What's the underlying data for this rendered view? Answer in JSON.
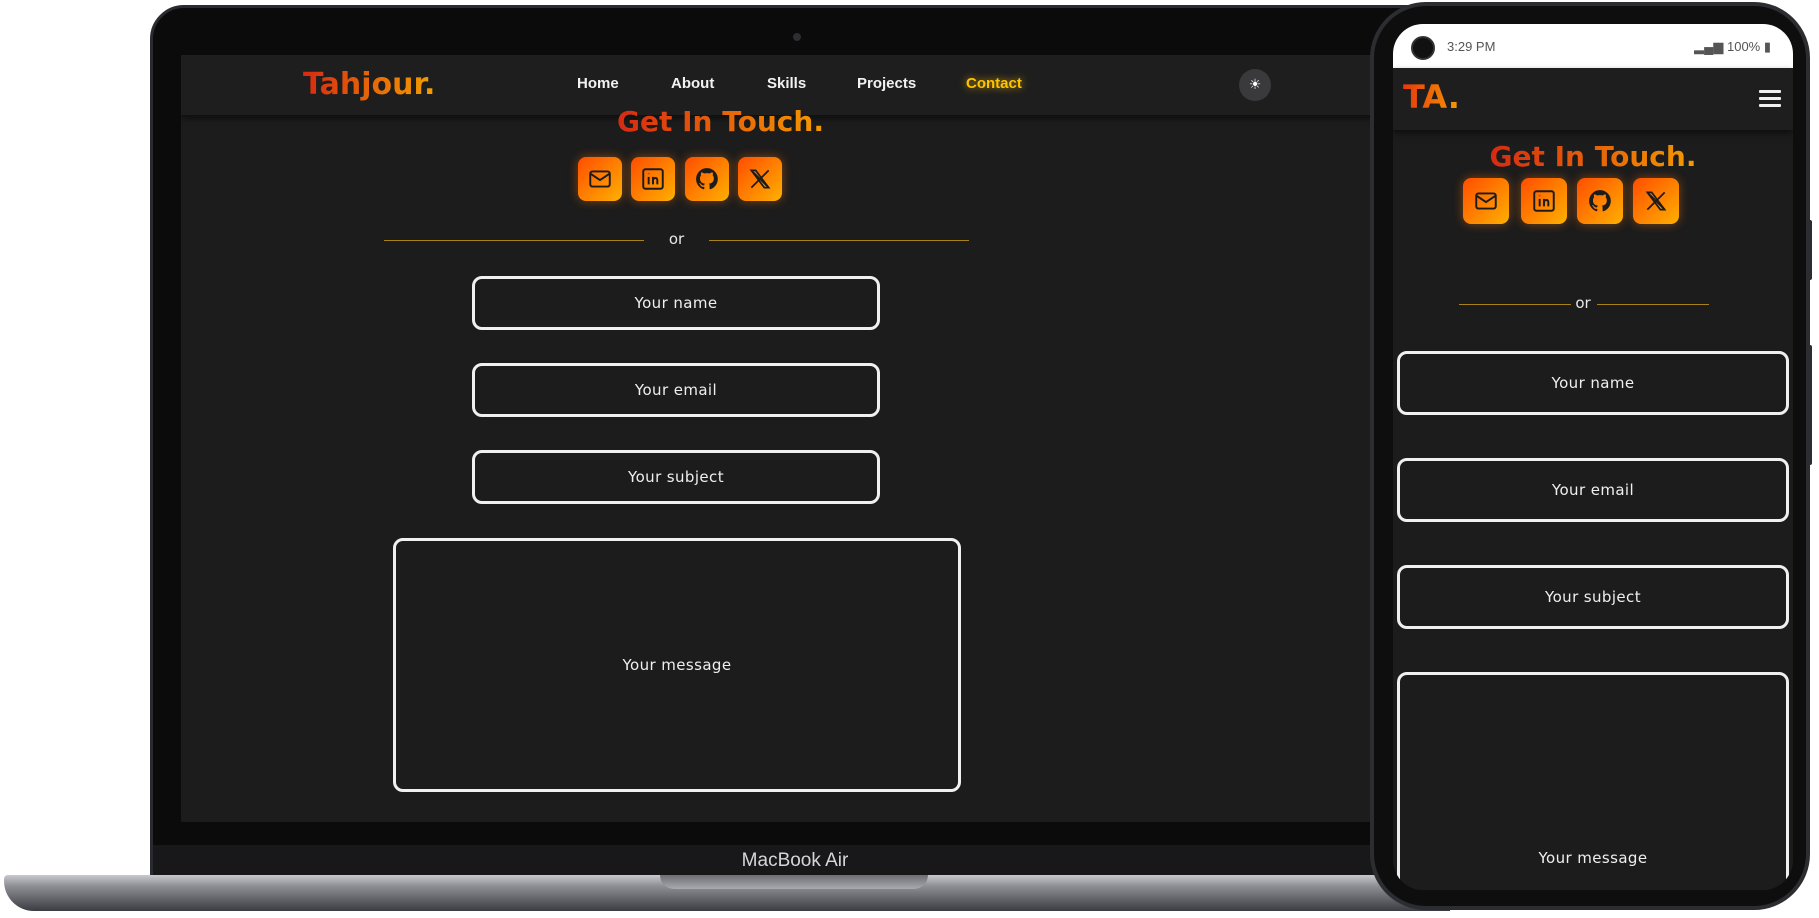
{
  "laptop": {
    "device_label": "MacBook Air",
    "nav": {
      "brand": "Tahjour.",
      "links": [
        "Home",
        "About",
        "Skills",
        "Projects",
        "Contact"
      ],
      "active": "Contact",
      "theme_icon": "sun-icon",
      "theme_glyph": "☀"
    },
    "contact": {
      "title": "Get In Touch.",
      "social_icons": [
        "mail-icon",
        "linkedin-icon",
        "github-icon",
        "x-icon"
      ],
      "divider_text": "or",
      "fields": {
        "name": "Your name",
        "email": "Your email",
        "subject": "Your subject",
        "message": "Your message"
      }
    }
  },
  "phone": {
    "status": {
      "time": "3:29 PM",
      "battery": "100%"
    },
    "nav": {
      "brand": "TA.",
      "menu_icon": "hamburger-icon"
    },
    "contact": {
      "title": "Get In Touch.",
      "social_icons": [
        "mail-icon",
        "linkedin-icon",
        "github-icon",
        "x-icon"
      ],
      "divider_text": "or",
      "fields": {
        "name": "Your name",
        "email": "Your email",
        "subject": "Your subject",
        "message": "Your message"
      }
    }
  },
  "colors": {
    "accent_start": "#d62a12",
    "accent_end": "#f5a000",
    "nav_active": "#ffc400",
    "background": "#1c1c1c"
  }
}
